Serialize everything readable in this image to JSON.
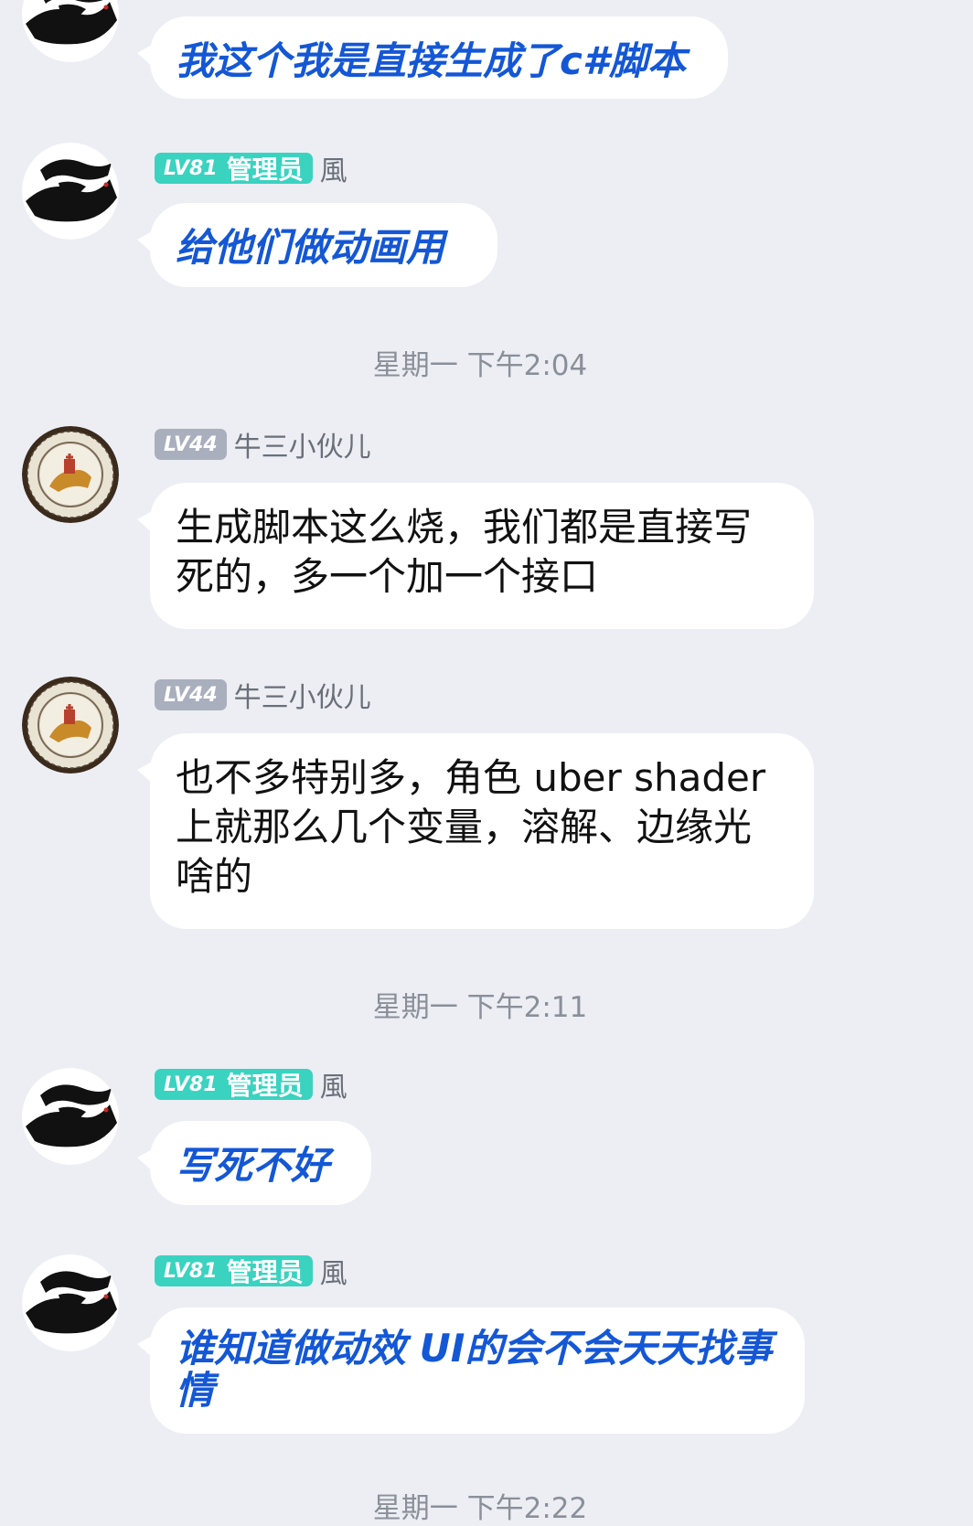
{
  "messages": [
    {
      "role_badge": "",
      "level": "",
      "name": "",
      "text": "我这个我是直接生成了c#脚本"
    },
    {
      "level": "LV81",
      "role_badge": "管理员",
      "name": "風",
      "text": "给他们做动画用"
    },
    {
      "level": "LV44",
      "name": "牛三小伙儿",
      "text": "生成脚本这么烧，我们都是直接写死的，多一个加一个接口"
    },
    {
      "level": "LV44",
      "name": "牛三小伙儿",
      "text": "也不多特别多，角色 uber shader 上就那么几个变量，溶解、边缘光啥的"
    },
    {
      "level": "LV81",
      "role_badge": "管理员",
      "name": "風",
      "text": "写死不好"
    },
    {
      "level": "LV81",
      "role_badge": "管理员",
      "name": "風",
      "text": "谁知道做动效 UI的会不会天天找事情"
    }
  ],
  "timestamps": [
    "星期一 下午2:04",
    "星期一 下午2:11",
    "星期一 下午2:22"
  ],
  "colors": {
    "background": "#eceef4",
    "admin_badge": "#3ad3c0",
    "member_badge": "#a9afbd",
    "styled_text": "#1457d6",
    "timestamp": "#8a8f99"
  },
  "icons": {
    "admin_avatar": "hands-avatar-icon",
    "member_avatar": "seal-avatar-icon"
  }
}
